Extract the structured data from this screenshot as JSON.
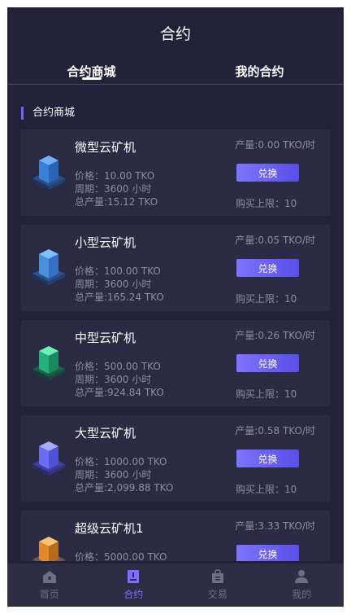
{
  "header": {
    "title": "合约"
  },
  "tabs": [
    {
      "label": "合约商城",
      "active": true
    },
    {
      "label": "我的合约",
      "active": false
    }
  ],
  "section": {
    "title": "合约商城"
  },
  "products": [
    {
      "name": "微型云矿机",
      "price": "价格：10.00 TKO",
      "period": "周期：3600 小时",
      "total": "总产量:15.12 TKO",
      "output": "产量:0.00 TKO/时",
      "button": "兑换",
      "limit": "购买上限：10",
      "color": "#3f7fd0"
    },
    {
      "name": "小型云矿机",
      "price": "价格：100.00 TKO",
      "period": "周期：3600 小时",
      "total": "总产量:165.24 TKO",
      "output": "产量:0.05 TKO/时",
      "button": "兑换",
      "limit": "购买上限：10",
      "color": "#4a8fdc"
    },
    {
      "name": "中型云矿机",
      "price": "价格：500.00 TKO",
      "period": "周期：3600 小时",
      "total": "总产量:924.84 TKO",
      "output": "产量:0.26 TKO/时",
      "button": "兑换",
      "limit": "购买上限：10",
      "color": "#25b07a"
    },
    {
      "name": "大型云矿机",
      "price": "价格：1000.00 TKO",
      "period": "周期：3600 小时",
      "total": "总产量:2,099.88 TKO",
      "output": "产量:0.58 TKO/时",
      "button": "兑换",
      "limit": "购买上限：10",
      "color": "#6a6cf5"
    },
    {
      "name": "超级云矿机1",
      "price": "价格：5000.00 TKO",
      "output": "产量:3.33 TKO/时",
      "button": "兑换",
      "color": "#e08a2c"
    }
  ],
  "nav": [
    {
      "label": "首页",
      "icon": "home-icon",
      "active": false
    },
    {
      "label": "合约",
      "icon": "contract-icon",
      "active": true
    },
    {
      "label": "交易",
      "icon": "trade-icon",
      "active": false
    },
    {
      "label": "我的",
      "icon": "user-icon",
      "active": false
    }
  ],
  "colors": {
    "background": "#22213a",
    "card": "#2a2a42",
    "accent": "#6f65f0",
    "nav_active": "#7b70ff"
  }
}
